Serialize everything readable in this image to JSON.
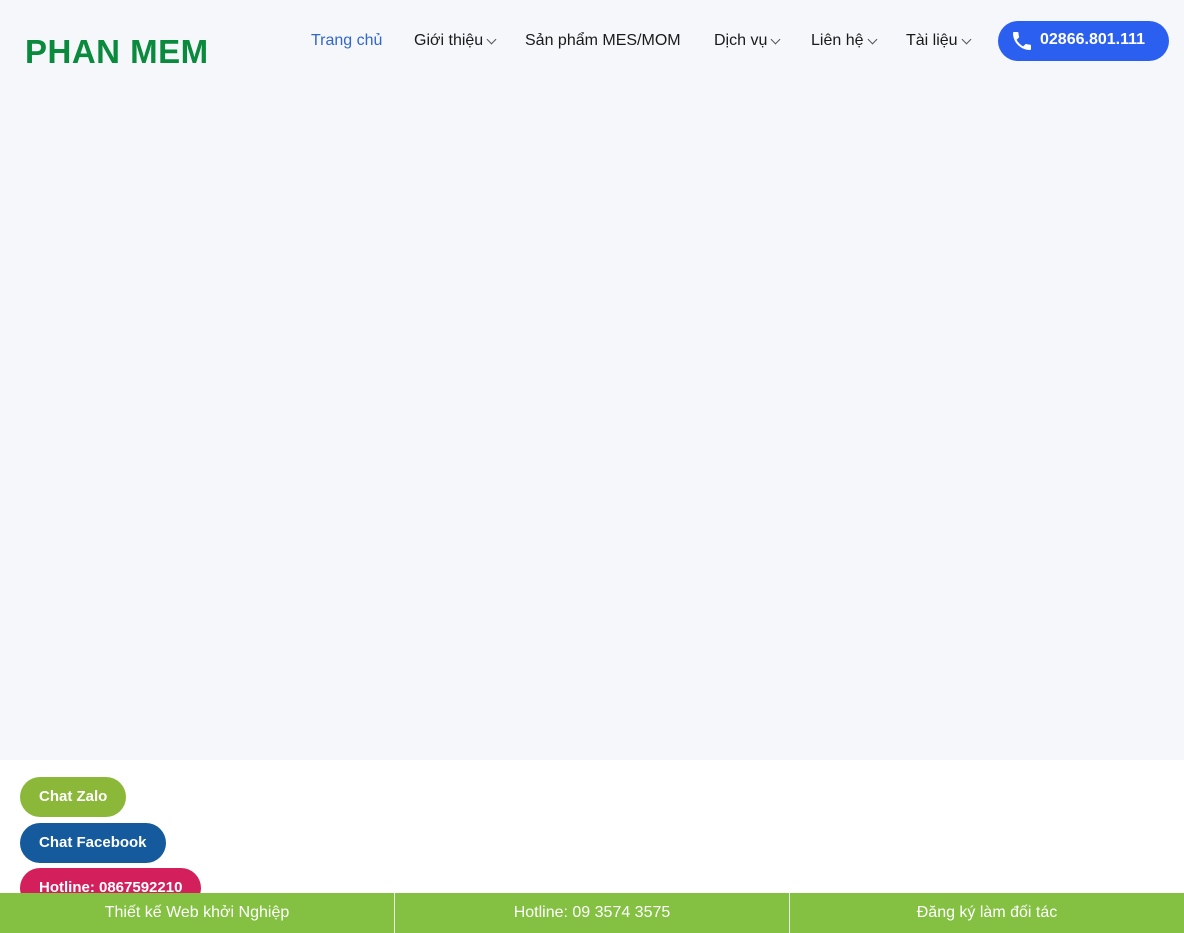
{
  "header": {
    "logo_text": "PHAN MEM",
    "phone_label": "02866.801.111"
  },
  "nav": {
    "items": [
      {
        "label": "Trang chủ",
        "active": true,
        "dropdown": false
      },
      {
        "label": "Giới thiệu",
        "active": false,
        "dropdown": true
      },
      {
        "label": "Sản phẩm MES/MOM",
        "active": false,
        "dropdown": false
      },
      {
        "label": "Dịch vụ",
        "active": false,
        "dropdown": true
      },
      {
        "label": "Liên hệ",
        "active": false,
        "dropdown": true
      },
      {
        "label": "Tài liệu",
        "active": false,
        "dropdown": true
      }
    ]
  },
  "floating": {
    "zalo_label": "Chat Zalo",
    "facebook_label": "Chat Facebook",
    "hotline_label": "Hotline: 0867592210"
  },
  "bottom_bar": {
    "items": [
      "Thiết kế Web khởi Nghiệp",
      "Hotline: 09 3574 3575",
      "Đăng ký làm đối tác"
    ]
  },
  "colors": {
    "logo": "#0a8a3c",
    "nav_active": "#3366cc",
    "phone_button": "#2b5ff0",
    "zalo": "#8cb83a",
    "facebook": "#155a9c",
    "hotline": "#d31f5c",
    "bottom_bar": "#84c142"
  }
}
